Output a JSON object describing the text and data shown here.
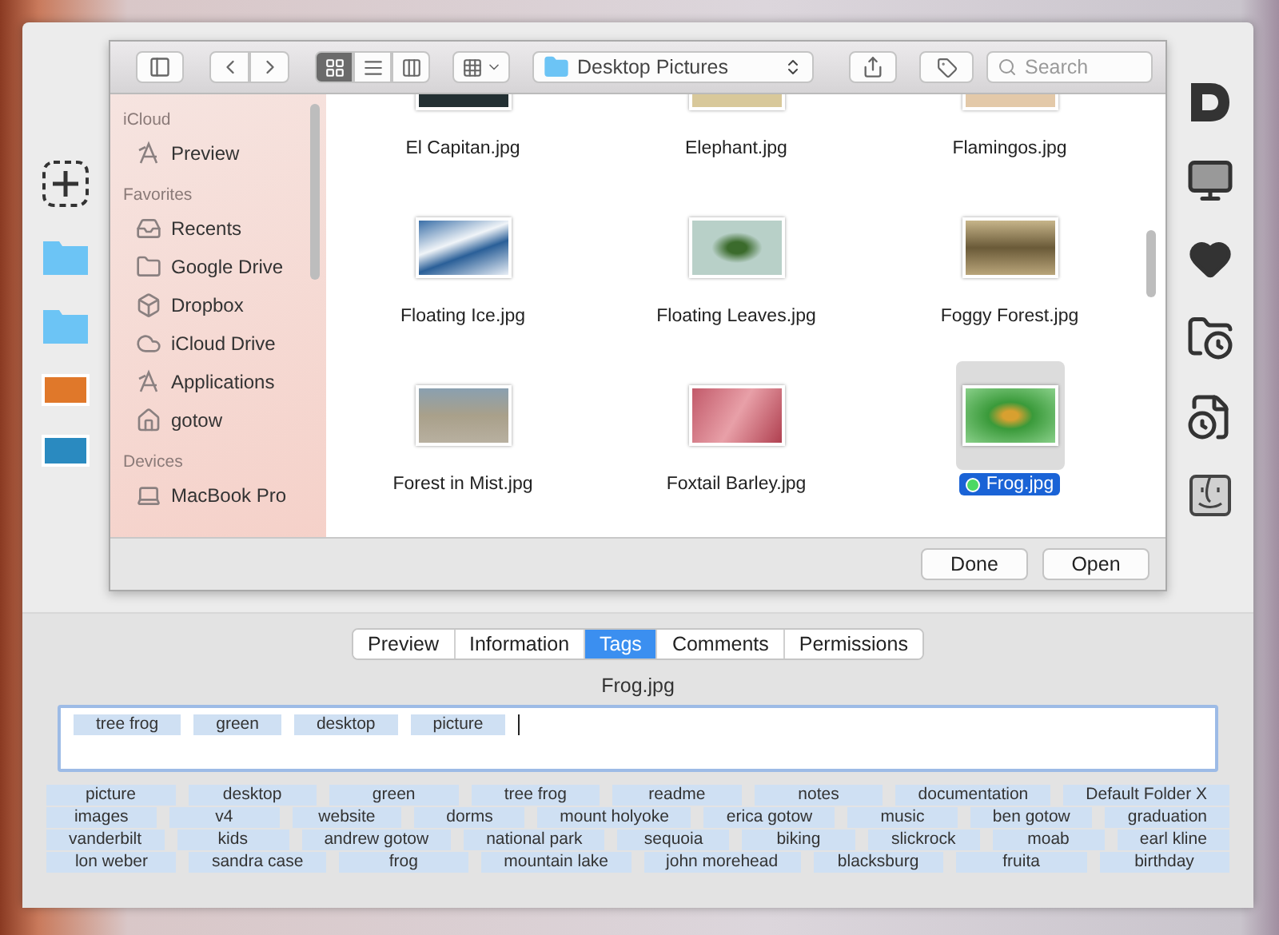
{
  "toolbar": {
    "views": [
      {
        "selected": true
      },
      {
        "selected": false
      },
      {
        "selected": false
      }
    ],
    "location": "Desktop Pictures",
    "search": {
      "placeholder": "Search"
    }
  },
  "sidebar": {
    "sections": [
      {
        "title": "iCloud",
        "items": [
          "Preview"
        ]
      },
      {
        "title": "Favorites",
        "items": [
          "Recents",
          "Google Drive",
          "Dropbox",
          "iCloud Drive",
          "Applications",
          "gotow"
        ]
      },
      {
        "title": "Devices",
        "items": [
          "MacBook Pro"
        ]
      }
    ]
  },
  "files": [
    {
      "name": "El Capitan.jpg",
      "selected": false
    },
    {
      "name": "Elephant.jpg",
      "selected": false
    },
    {
      "name": "Flamingos.jpg",
      "selected": false
    },
    {
      "name": "Floating Ice.jpg",
      "selected": false
    },
    {
      "name": "Floating Leaves.jpg",
      "selected": false
    },
    {
      "name": "Foggy Forest.jpg",
      "selected": false
    },
    {
      "name": "Forest in Mist.jpg",
      "selected": false
    },
    {
      "name": "Foxtail Barley.jpg",
      "selected": false
    },
    {
      "name": "Frog.jpg",
      "selected": true,
      "color": "#4cd964"
    }
  ],
  "buttons": [
    "Done",
    "Open"
  ],
  "tabs": [
    {
      "label": "Preview",
      "selected": false
    },
    {
      "label": "Information",
      "selected": false
    },
    {
      "label": "Tags",
      "selected": true
    },
    {
      "label": "Comments",
      "selected": false
    },
    {
      "label": "Permissions",
      "selected": false
    }
  ],
  "file_name": "Frog.jpg",
  "tag_field": {
    "tags": [
      "tree frog",
      "green",
      "desktop",
      "picture"
    ]
  },
  "tag_cloud": [
    [
      "picture",
      "desktop",
      "green",
      "tree frog",
      "readme",
      "notes",
      "documentation",
      "Default Folder X"
    ],
    [
      "images",
      "v4",
      "website",
      "dorms",
      "mount holyoke",
      "erica gotow",
      "music",
      "ben gotow",
      "graduation"
    ],
    [
      "vanderbilt",
      "kids",
      "andrew gotow",
      "national park",
      "sequoia",
      "biking",
      "slickrock",
      "moab",
      "earl kline"
    ],
    [
      "lon weber",
      "sandra case",
      "frog",
      "mountain lake",
      "john morehead",
      "blacksburg",
      "fruita",
      "birthday"
    ]
  ]
}
